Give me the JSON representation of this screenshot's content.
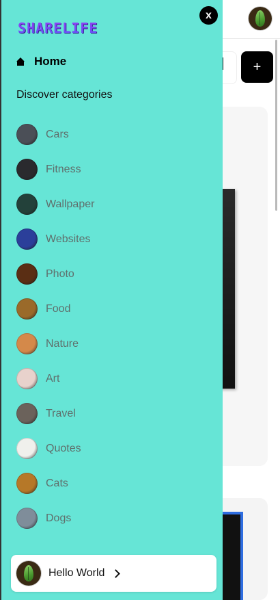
{
  "app": {
    "logo_text": "SHARELIFE",
    "close_label": "x"
  },
  "nav": {
    "home_label": "Home",
    "discover_heading": "Discover categories",
    "categories": [
      {
        "label": "Cars",
        "icon": "cars-thumbnail",
        "color": "#4b4f57"
      },
      {
        "label": "Fitness",
        "icon": "fitness-thumbnail",
        "color": "#2a2a2e"
      },
      {
        "label": "Wallpaper",
        "icon": "wallpaper-thumbnail",
        "color": "#23413a"
      },
      {
        "label": "Websites",
        "icon": "websites-thumbnail",
        "color": "#2b3f9a"
      },
      {
        "label": "Photo",
        "icon": "photo-thumbnail",
        "color": "#5a2e14"
      },
      {
        "label": "Food",
        "icon": "food-thumbnail",
        "color": "#9a6a2a"
      },
      {
        "label": "Nature",
        "icon": "nature-thumbnail",
        "color": "#d4894a"
      },
      {
        "label": "Art",
        "icon": "art-thumbnail",
        "color": "#e8d2cc"
      },
      {
        "label": "Travel",
        "icon": "travel-thumbnail",
        "color": "#6b625b"
      },
      {
        "label": "Quotes",
        "icon": "quotes-thumbnail",
        "color": "#f0f0ec"
      },
      {
        "label": "Cats",
        "icon": "cats-thumbnail",
        "color": "#b67828"
      },
      {
        "label": "Dogs",
        "icon": "dogs-thumbnail",
        "color": "#7f8d9a"
      }
    ]
  },
  "user": {
    "name": "Hello World"
  },
  "background": {
    "add_label": "+"
  },
  "colors": {
    "drawer_bg": "#66e5d6",
    "accent_black": "#000000"
  }
}
